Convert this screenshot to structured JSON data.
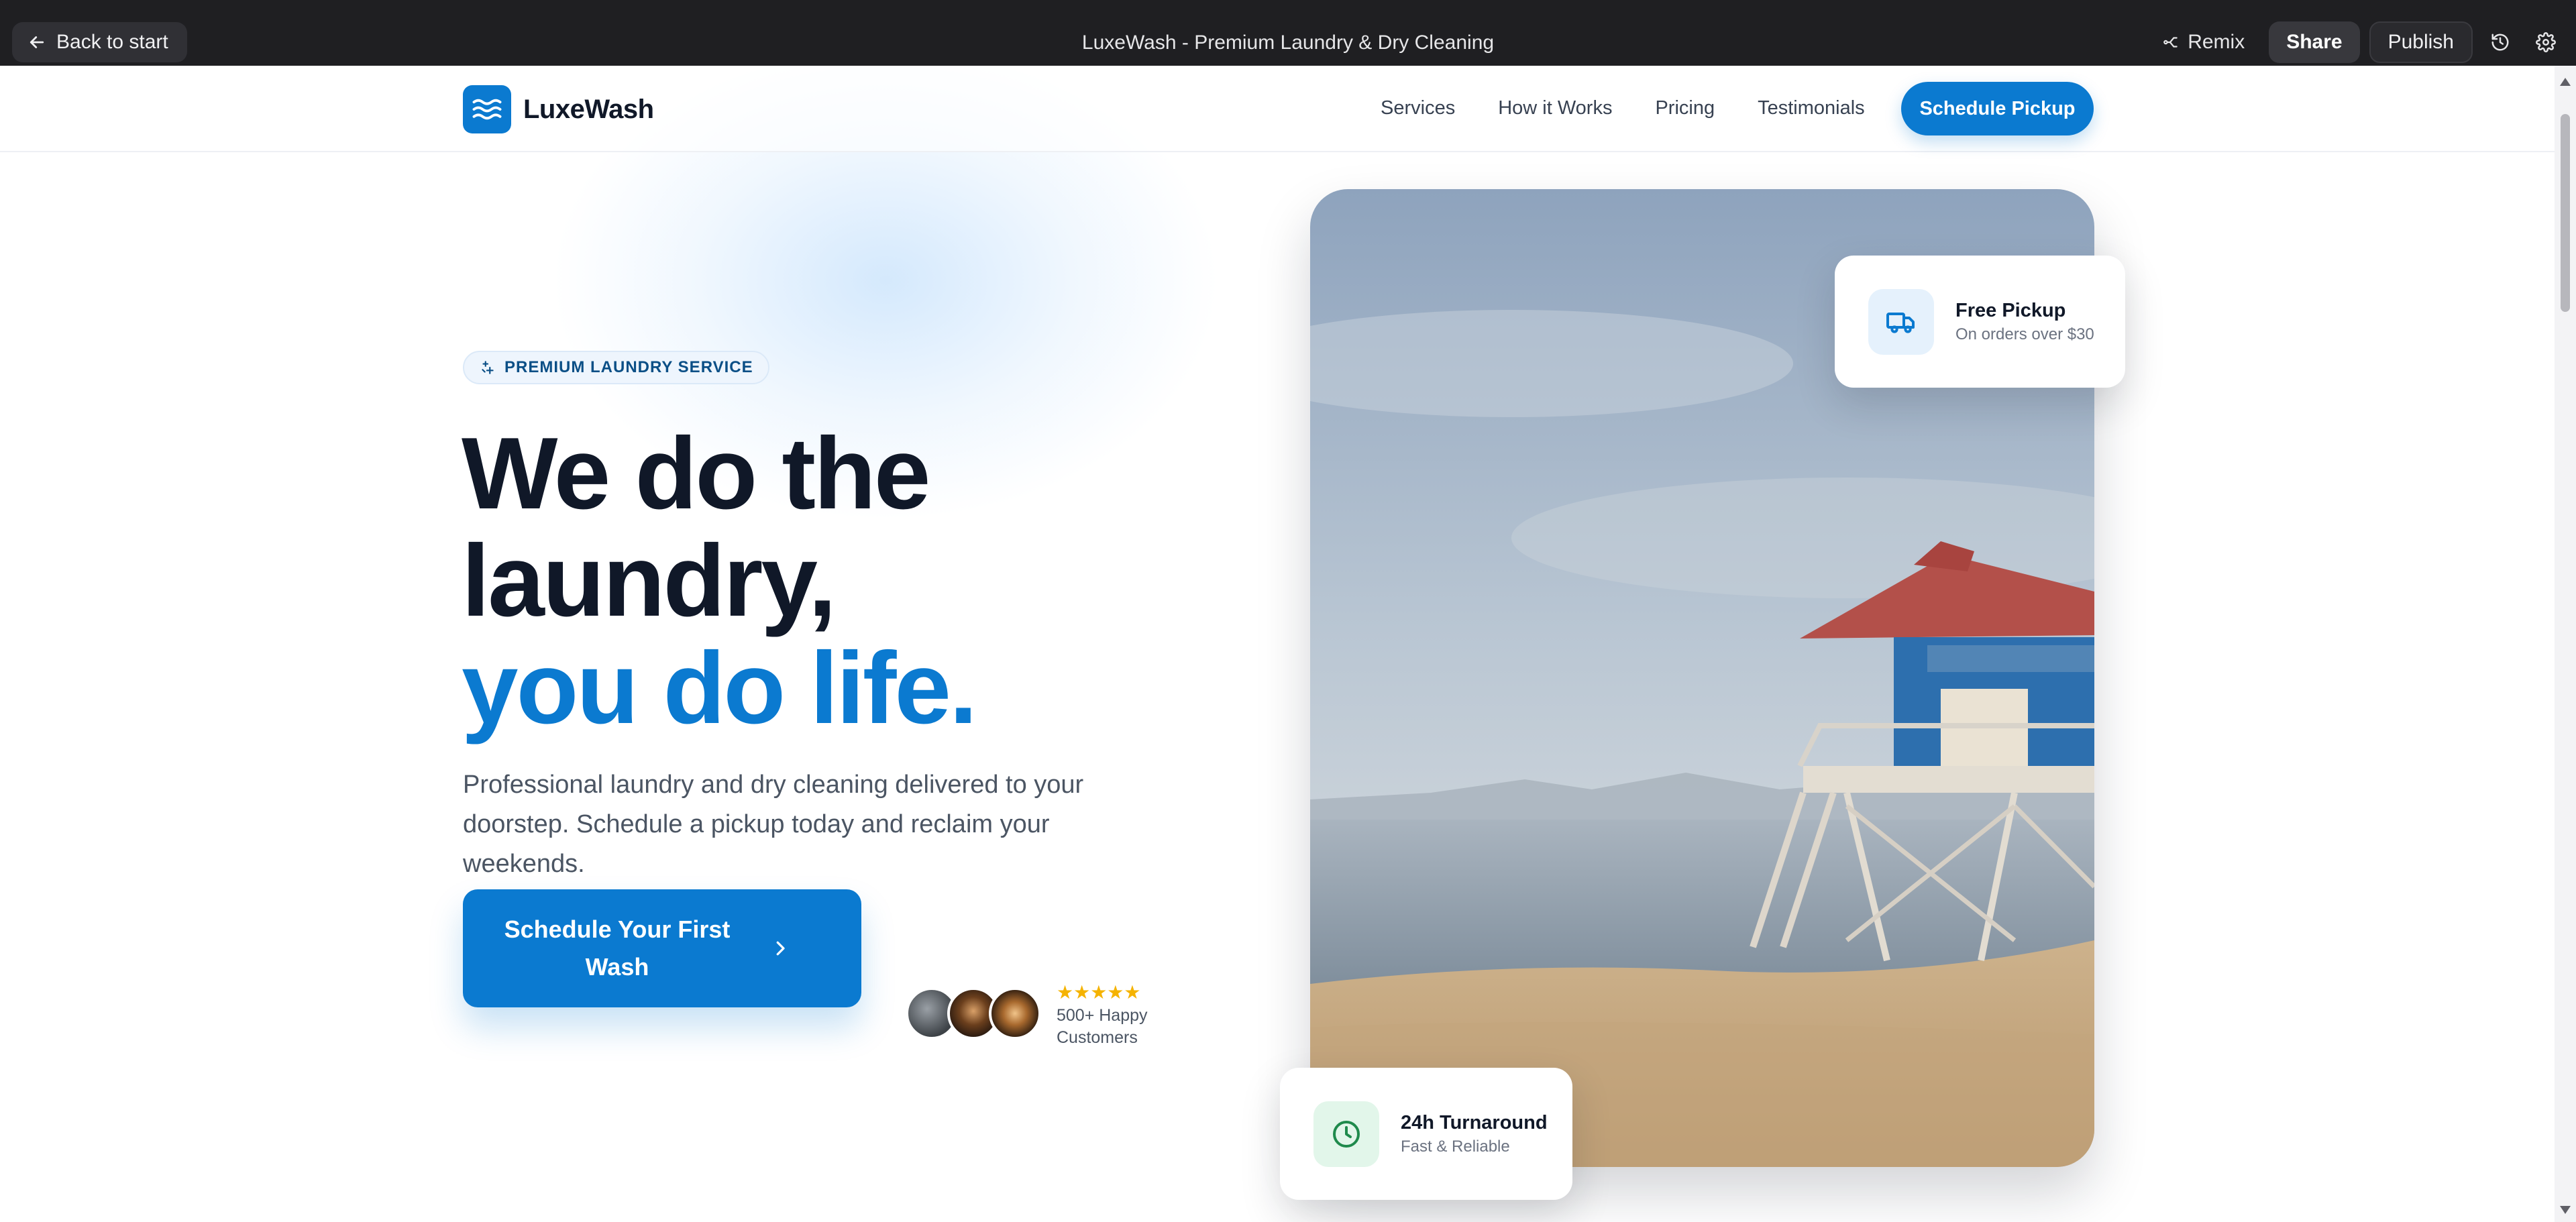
{
  "editor": {
    "back_label": "Back to start",
    "window_title": "LuxeWash - Premium Laundry & Dry Cleaning",
    "remix_label": "Remix",
    "share_label": "Share",
    "publish_label": "Publish"
  },
  "nav": {
    "brand": "LuxeWash",
    "links": [
      "Services",
      "How it Works",
      "Pricing",
      "Testimonials"
    ],
    "cta_label": "Schedule Pickup"
  },
  "hero": {
    "badge": "PREMIUM LAUNDRY SERVICE",
    "title_line1": "We do the",
    "title_line2": "laundry,",
    "title_accent": "you do life.",
    "subtitle": "Professional laundry and dry cleaning delivered to your doorstep. Schedule a pickup today and reclaim your weekends.",
    "cta_label": "Schedule Your First Wash",
    "rating_stars": "★★★★★",
    "rating_text": "500+ Happy Customers"
  },
  "cards": {
    "pickup": {
      "title": "Free Pickup",
      "subtitle": "On orders over $30",
      "icon": "truck-icon"
    },
    "turnaround": {
      "title": "24h Turnaround",
      "subtitle": "Fast & Reliable",
      "icon": "clock-icon"
    }
  },
  "colors": {
    "accent": "#0b7ad0",
    "heading": "#101828",
    "topbar": "#1f1f22",
    "star": "#f5b301"
  }
}
